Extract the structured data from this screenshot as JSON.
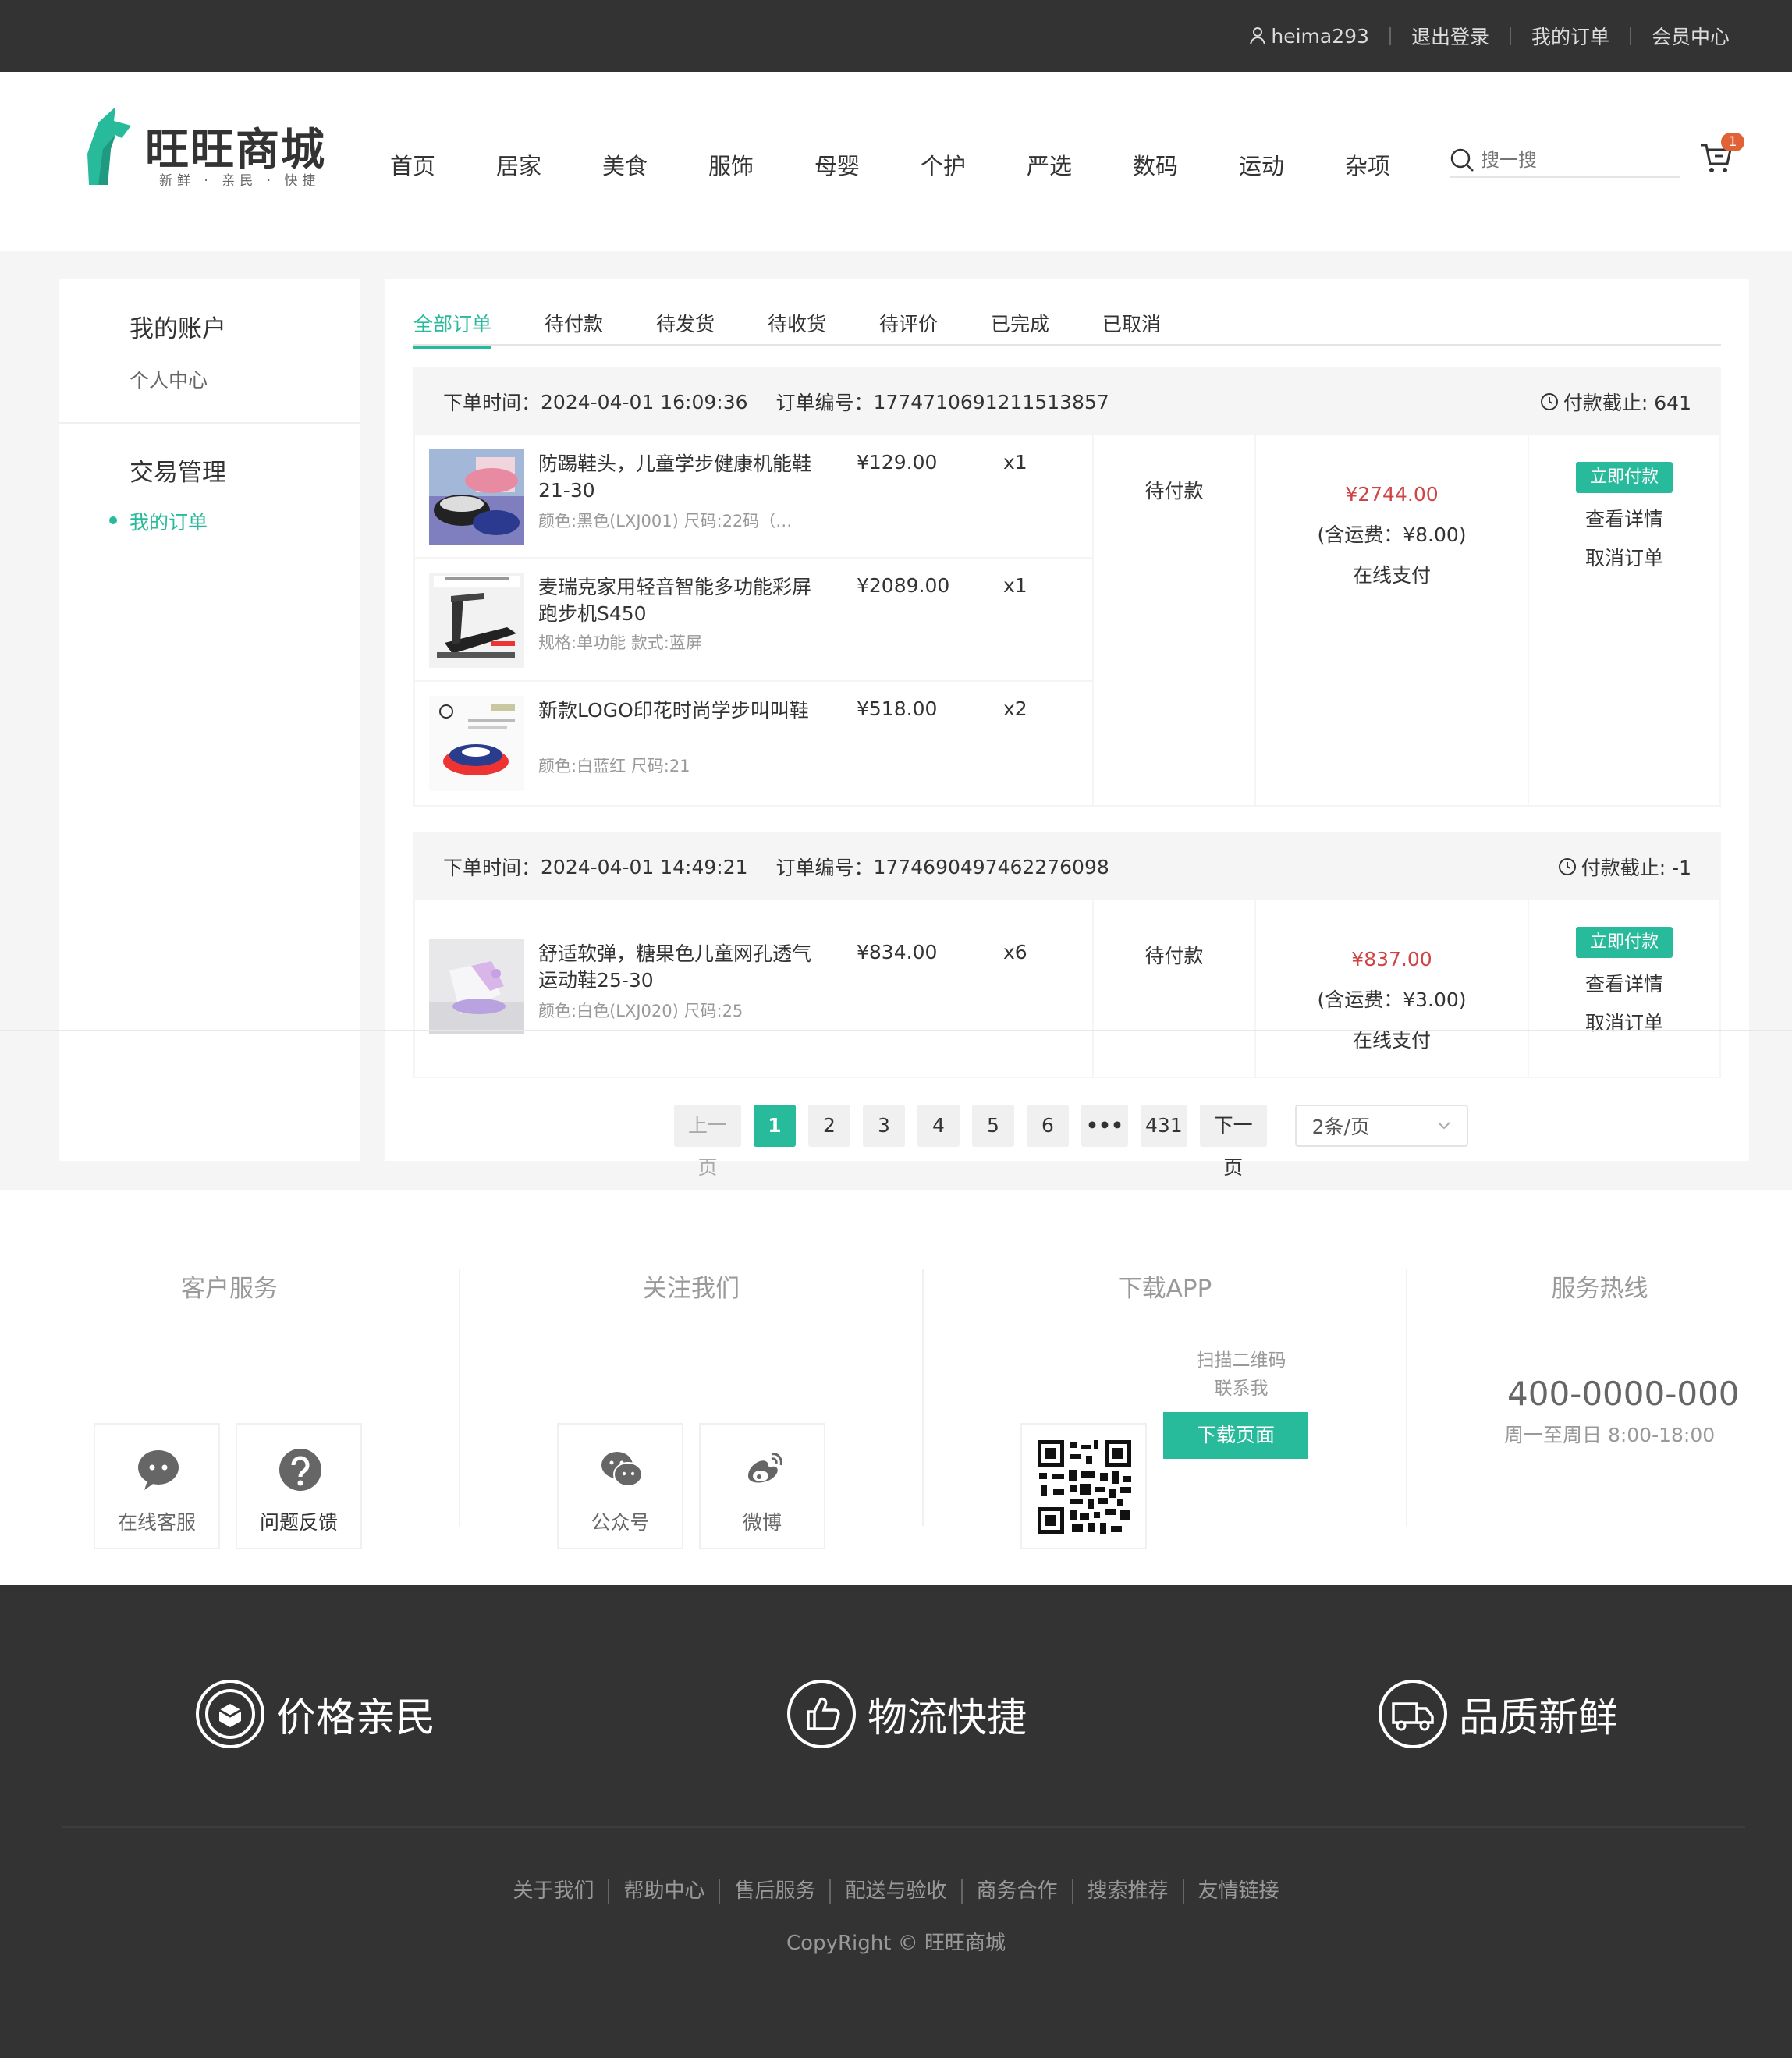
{
  "topbar": {
    "username": "heima293",
    "links": [
      "退出登录",
      "我的订单",
      "会员中心"
    ]
  },
  "logo": {
    "name": "旺旺商城",
    "tagline": "新鲜 · 亲民 · 快捷"
  },
  "nav": [
    "首页",
    "居家",
    "美食",
    "服饰",
    "母婴",
    "个护",
    "严选",
    "数码",
    "运动",
    "杂项"
  ],
  "search": {
    "placeholder": "搜一搜",
    "icon": "search-icon"
  },
  "cart": {
    "count": "1",
    "icon": "cart-icon"
  },
  "sidebar": {
    "groups": [
      {
        "title": "我的账户",
        "items": [
          "个人中心"
        ]
      },
      {
        "title": "交易管理",
        "items": [
          "我的订单"
        ]
      }
    ],
    "active": "我的订单"
  },
  "tabs": [
    "全部订单",
    "待付款",
    "待发货",
    "待收货",
    "待评价",
    "已完成",
    "已取消"
  ],
  "active_tab": "全部订单",
  "orders": [
    {
      "time_label": "下单时间：",
      "time": "2024-04-01 16:09:36",
      "no_label": "订单编号：",
      "no": "1774710691211513857",
      "deadline": "付款截止: 641",
      "goods": [
        {
          "name": "防踢鞋头，儿童学步健康机能鞋21-30",
          "attr": "颜色:黑色(LXJ001) 尺码:22码（脚...",
          "price": "¥129.00",
          "qty": "x1"
        },
        {
          "name": "麦瑞克家用轻音智能多功能彩屏跑步机S450",
          "attr": "规格:单功能 款式:蓝屏",
          "price": "¥2089.00",
          "qty": "x1"
        },
        {
          "name": "新款LOGO印花时尚学步叫叫鞋",
          "attr": "颜色:白蓝红 尺码:21",
          "price": "¥518.00",
          "qty": "x2"
        }
      ],
      "state": "待付款",
      "amount": "¥2744.00",
      "freight": "(含运费：¥8.00)",
      "pay_type": "在线支付",
      "actions": {
        "pay": "立即付款",
        "detail": "查看详情",
        "cancel": "取消订单"
      }
    },
    {
      "time_label": "下单时间：",
      "time": "2024-04-01 14:49:21",
      "no_label": "订单编号：",
      "no": "1774690497462276098",
      "deadline": "付款截止: -1",
      "goods": [
        {
          "name": "舒适软弹，糖果色儿童网孔透气运动鞋25-30",
          "attr": "颜色:白色(LXJ020) 尺码:25",
          "price": "¥834.00",
          "qty": "x6"
        }
      ],
      "state": "待付款",
      "amount": "¥837.00",
      "freight": "(含运费：¥3.00)",
      "pay_type": "在线支付",
      "actions": {
        "pay": "立即付款",
        "detail": "查看详情",
        "cancel": "取消订单"
      }
    }
  ],
  "pager": {
    "prev": "上一页",
    "pages": [
      "1",
      "2",
      "3",
      "4",
      "5",
      "6",
      "•••",
      "431"
    ],
    "current": "1",
    "next": "下一页",
    "page_size": "2条/页"
  },
  "service": {
    "customer": {
      "title": "客户服务",
      "items": [
        {
          "label": "在线客服",
          "icon": "chat-bubble-icon"
        },
        {
          "label": "问题反馈",
          "icon": "question-icon"
        }
      ]
    },
    "follow": {
      "title": "关注我们",
      "items": [
        {
          "label": "公众号",
          "icon": "wechat-icon"
        },
        {
          "label": "微博",
          "icon": "weibo-icon"
        }
      ]
    },
    "app": {
      "title": "下载APP",
      "scan": "扫描二维码",
      "contact": "联系我",
      "button": "下载页面"
    },
    "hotline": {
      "title": "服务热线",
      "phone": "400-0000-000",
      "hours": "周一至周日 8:00-18:00"
    }
  },
  "footer": {
    "promises": [
      {
        "label": "价格亲民",
        "icon": "price-icon"
      },
      {
        "label": "物流快捷",
        "icon": "thumbs-up-icon"
      },
      {
        "label": "品质新鲜",
        "icon": "truck-icon"
      }
    ],
    "links": [
      "关于我们",
      "帮助中心",
      "售后服务",
      "配送与验收",
      "商务合作",
      "搜索推荐",
      "友情链接"
    ],
    "copyright": "CopyRight © 旺旺商城"
  },
  "colors": {
    "accent": "#27ba9b",
    "price": "#cf4444",
    "badge": "#e26237",
    "dark": "#333333"
  }
}
